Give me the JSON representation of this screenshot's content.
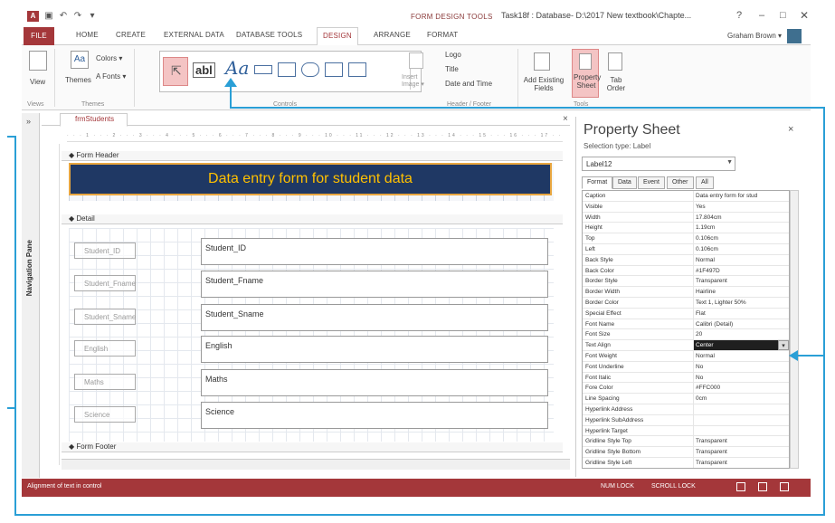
{
  "titlebar": {
    "context_label": "FORM DESIGN TOOLS",
    "title": "Task18f : Database- D:\\2017 New textbook\\Chapte...",
    "help": "?",
    "minimize": "–",
    "maximize": "□",
    "close": "✕"
  },
  "tabs": {
    "file": "FILE",
    "items": [
      "HOME",
      "CREATE",
      "EXTERNAL DATA",
      "DATABASE TOOLS",
      "DESIGN",
      "ARRANGE",
      "FORMAT"
    ],
    "user": "Graham Brown ▾"
  },
  "ribbon": {
    "view": "View",
    "themes": "Themes",
    "colors": "Colors ▾",
    "fonts": "A Fonts ▾",
    "abl": "abl",
    "aa": "Aa",
    "insert_image": "Insert Image ▾",
    "logo": "Logo",
    "title": "Title",
    "date_time": "Date and Time",
    "add_existing_fields": "Add Existing Fields",
    "property_sheet": "Property Sheet",
    "tab_order": "Tab Order",
    "groups": {
      "views": "Views",
      "themes": "Themes",
      "controls": "Controls",
      "header_footer": "Header / Footer",
      "tools": "Tools"
    }
  },
  "nav": {
    "label": "Navigation Pane",
    "toggle": "»"
  },
  "doc": {
    "tab_label": "frmStudents",
    "close": "×",
    "form_header": "Form Header",
    "detail": "Detail",
    "form_footer": "Form Footer",
    "header_label": "Data entry form for student data",
    "fields": [
      {
        "label": "Student_ID",
        "field": "Student_ID"
      },
      {
        "label": "Student_Fname",
        "field": "Student_Fname"
      },
      {
        "label": "Student_Sname",
        "field": "Student_Sname"
      },
      {
        "label": "English",
        "field": "English"
      },
      {
        "label": "Maths",
        "field": "Maths"
      },
      {
        "label": "Science",
        "field": "Science"
      }
    ]
  },
  "property_sheet": {
    "title": "Property Sheet",
    "close": "×",
    "selection_type": "Selection type: Label",
    "selected": "Label12",
    "tabs": [
      "Format",
      "Data",
      "Event",
      "Other",
      "All"
    ],
    "rows": [
      {
        "name": "Caption",
        "value": "Data entry form for stud"
      },
      {
        "name": "Visible",
        "value": "Yes"
      },
      {
        "name": "Width",
        "value": "17.804cm"
      },
      {
        "name": "Height",
        "value": "1.19cm"
      },
      {
        "name": "Top",
        "value": "0.106cm"
      },
      {
        "name": "Left",
        "value": "0.106cm"
      },
      {
        "name": "Back Style",
        "value": "Normal"
      },
      {
        "name": "Back Color",
        "value": "#1F497D"
      },
      {
        "name": "Border Style",
        "value": "Transparent"
      },
      {
        "name": "Border Width",
        "value": "Hairline"
      },
      {
        "name": "Border Color",
        "value": "Text 1, Lighter 50%"
      },
      {
        "name": "Special Effect",
        "value": "Flat"
      },
      {
        "name": "Font Name",
        "value": "Calibri (Detail)"
      },
      {
        "name": "Font Size",
        "value": "20"
      },
      {
        "name": "Text Align",
        "value": "Center"
      },
      {
        "name": "Font Weight",
        "value": "Normal"
      },
      {
        "name": "Font Underline",
        "value": "No"
      },
      {
        "name": "Font Italic",
        "value": "No"
      },
      {
        "name": "Fore Color",
        "value": "#FFC000"
      },
      {
        "name": "Line Spacing",
        "value": "0cm"
      },
      {
        "name": "Hyperlink Address",
        "value": ""
      },
      {
        "name": "Hyperlink SubAddress",
        "value": ""
      },
      {
        "name": "Hyperlink Target",
        "value": ""
      },
      {
        "name": "Gridline Style Top",
        "value": "Transparent"
      },
      {
        "name": "Gridline Style Bottom",
        "value": "Transparent"
      },
      {
        "name": "Gridline Style Left",
        "value": "Transparent"
      }
    ]
  },
  "status": {
    "text": "Alignment of text in control",
    "num_lock": "NUM LOCK",
    "scroll_lock": "SCROLL LOCK"
  },
  "colors": {
    "accent": "#A4373A",
    "header_back": "#1F3864",
    "header_fore": "#FFC000",
    "callout": "#2A9FD6"
  }
}
